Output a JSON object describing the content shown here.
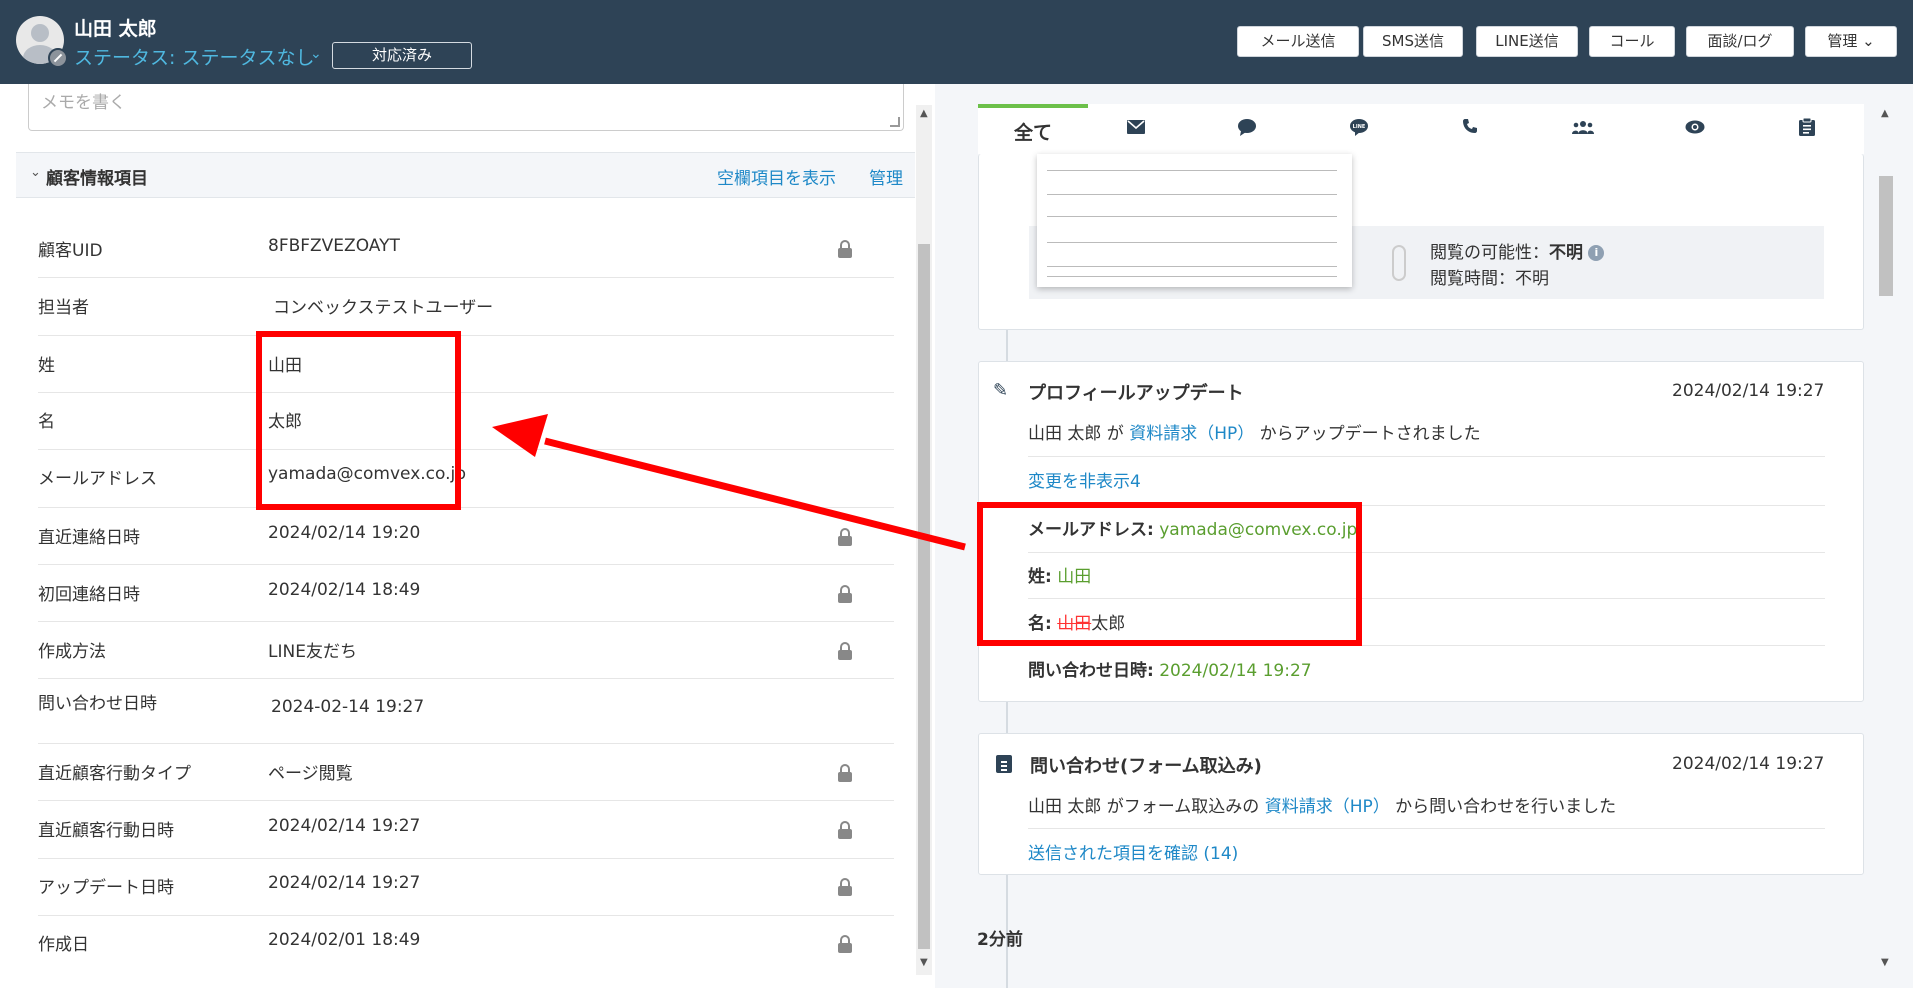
{
  "header": {
    "user_name": "山田 太郎",
    "status": "ステータス: ステータスなし",
    "handled_label": "対応済み",
    "buttons": [
      "メール送信",
      "SMS送信",
      "LINE送信",
      "コール",
      "面談/ログ",
      "管理 ⌄"
    ]
  },
  "memo": {
    "placeholder": "メモを書く"
  },
  "customer_section": {
    "title": "顧客情報項目",
    "show_empty_label": "空欄項目を表示",
    "manage_label": "管理"
  },
  "fields": [
    {
      "label": "顧客UID",
      "value": "8FBFZVEZOAYT",
      "locked": true
    },
    {
      "label": "担当者",
      "value": "コンベックステストユーザー",
      "locked": false
    },
    {
      "label": "姓",
      "value": "山田",
      "locked": false
    },
    {
      "label": "名",
      "value": "太郎",
      "locked": false
    },
    {
      "label": "メールアドレス",
      "value": "yamada@comvex.co.jp",
      "locked": false
    },
    {
      "label": "直近連絡日時",
      "value": "2024/02/14 19:20",
      "locked": true
    },
    {
      "label": "初回連絡日時",
      "value": "2024/02/14 18:49",
      "locked": true
    },
    {
      "label": "作成方法",
      "value": "LINE友だち",
      "locked": true
    },
    {
      "label": "問い合わせ日時",
      "value": "2024-02-14 19:27",
      "locked": false
    },
    {
      "label": "直近顧客行動タイプ",
      "value": "ページ閲覧",
      "locked": true
    },
    {
      "label": "直近顧客行動日時",
      "value": "2024/02/14 19:27",
      "locked": true
    },
    {
      "label": "アップデート日時",
      "value": "2024/02/14 19:27",
      "locked": true
    },
    {
      "label": "作成日",
      "value": "2024/02/01 18:49",
      "locked": true
    }
  ],
  "tabs": {
    "all_label": "全て"
  },
  "view_card": {
    "possibility_label": "閲覧の可能性：",
    "possibility_value": "不明",
    "time_label": "閲覧時間：不明"
  },
  "profile_card": {
    "title": "プロフィールアップデート",
    "date": "2024/02/14 19:27",
    "user": "山田 太郎 が",
    "source_link": "資料請求（HP）",
    "suffix": "からアップデートされました",
    "toggle_link": "変更を非表示4",
    "email_label": "メールアドレス:",
    "email_value": "yamada@comvex.co.jp",
    "last_name_label": "姓:",
    "last_name_value": "山田",
    "first_name_label": "名:",
    "first_name_old": "山田",
    "first_name_new": "太郎",
    "inquiry_label": "問い合わせ日時:",
    "inquiry_value": "2024/02/14 19:27"
  },
  "inquiry_card": {
    "title": "問い合わせ(フォーム取込み)",
    "date": "2024/02/14 19:27",
    "user": "山田 太郎 がフォーム取込みの",
    "source_link": "資料請求（HP）",
    "suffix": "から問い合わせを行いました",
    "confirm_link": "送信された項目を確認 (14)"
  },
  "time_ago": "2分前",
  "colors": {
    "header_bg": "#2e4356",
    "accent": "#1e88c7",
    "green": "#5a9e2f",
    "annotation": "#ff0000"
  }
}
